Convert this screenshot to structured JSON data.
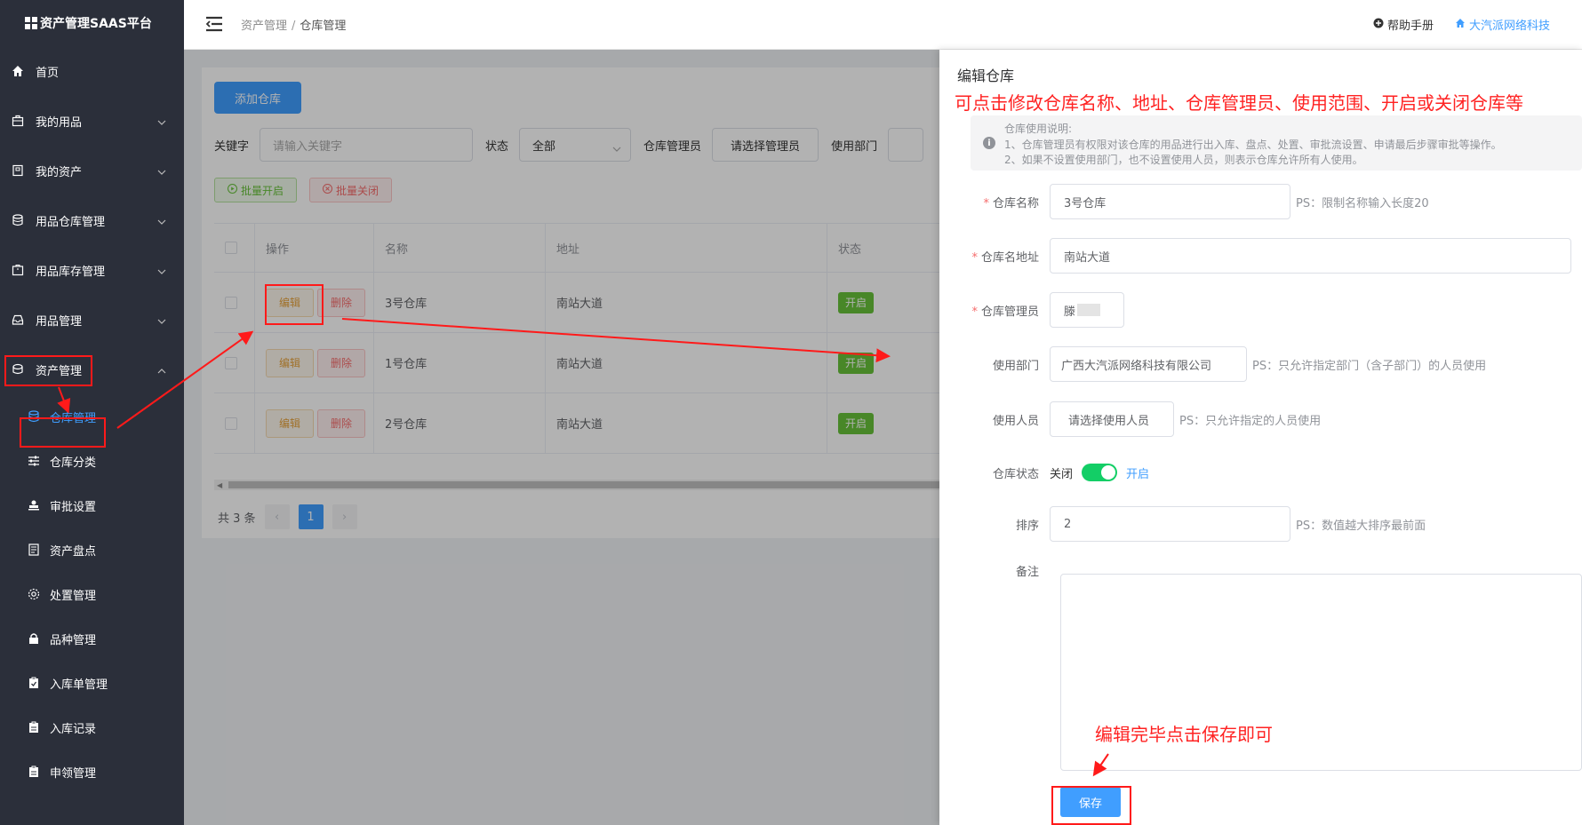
{
  "app": {
    "title": "资产管理SAAS平台"
  },
  "sidebar": {
    "items": [
      {
        "label": "首页",
        "icon": "home-icon"
      },
      {
        "label": "我的用品",
        "icon": "bag-icon"
      },
      {
        "label": "我的资产",
        "icon": "building-icon"
      },
      {
        "label": "用品仓库管理",
        "icon": "database-icon"
      },
      {
        "label": "用品库存管理",
        "icon": "box-icon"
      },
      {
        "label": "用品管理",
        "icon": "tray-icon"
      },
      {
        "label": "资产管理",
        "icon": "asset-icon"
      }
    ],
    "subitems": [
      {
        "label": "仓库管理",
        "icon": "database-icon"
      },
      {
        "label": "仓库分类",
        "icon": "sliders-icon"
      },
      {
        "label": "审批设置",
        "icon": "stamp-icon"
      },
      {
        "label": "资产盘点",
        "icon": "document-icon"
      },
      {
        "label": "处置管理",
        "icon": "gear-icon"
      },
      {
        "label": "品种管理",
        "icon": "lock-icon"
      },
      {
        "label": "入库单管理",
        "icon": "clipboard-icon"
      },
      {
        "label": "入库记录",
        "icon": "clipboard-icon"
      },
      {
        "label": "申领管理",
        "icon": "clipboard-icon"
      }
    ]
  },
  "header": {
    "breadcrumb": [
      "资产管理",
      "仓库管理"
    ],
    "help": "帮助手册",
    "company": "大汽派网络科技"
  },
  "main": {
    "add_button": "添加仓库",
    "filters": {
      "keyword_label": "关键字",
      "keyword_placeholder": "请输入关键字",
      "status_label": "状态",
      "status_value": "全部",
      "manager_label": "仓库管理员",
      "manager_button": "请选择管理员",
      "dept_label": "使用部门"
    },
    "batch_open": "批量开启",
    "batch_close": "批量关闭",
    "table": {
      "headers": [
        "操作",
        "名称",
        "地址",
        "状态"
      ],
      "edit": "编辑",
      "delete": "删除",
      "rows": [
        {
          "name": "3号仓库",
          "address": "南站大道",
          "status": "开启"
        },
        {
          "name": "1号仓库",
          "address": "南站大道",
          "status": "开启"
        },
        {
          "name": "2号仓库",
          "address": "南站大道",
          "status": "开启"
        }
      ]
    },
    "pagination": {
      "total": "共 3 条",
      "prev": "‹",
      "current": "1",
      "next": "›"
    }
  },
  "drawer": {
    "title": "编辑仓库",
    "annotation_top": "可点击修改仓库名称、地址、仓库管理员、使用范围、开启或关闭仓库等",
    "tip_title": "仓库使用说明:",
    "tip_line1": "1、仓库管理员有权限对该仓库的用品进行出入库、盘点、处置、审批流设置、申请最后步骤审批等操作。",
    "tip_line2": "2、如果不设置使用部门，也不设置使用人员，则表示仓库允许所有人使用。",
    "fields": {
      "name_label": "仓库名称",
      "name_value": "3号仓库",
      "name_ps": "PS：限制名称输入长度20",
      "address_label": "仓库名地址",
      "address_value": "南站大道",
      "manager_label": "仓库管理员",
      "manager_value": "滕",
      "dept_label": "使用部门",
      "dept_value": "广西大汽派网络科技有限公司",
      "dept_ps": "PS：只允许指定部门（含子部门）的人员使用",
      "user_label": "使用人员",
      "user_button": "请选择使用人员",
      "user_ps": "PS：只允许指定的人员使用",
      "status_label": "仓库状态",
      "status_off": "关闭",
      "status_on": "开启",
      "sort_label": "排序",
      "sort_value": "2",
      "sort_ps": "PS：数值越大排序最前面",
      "remark_label": "备注"
    },
    "annotation_bottom": "编辑完毕点击保存即可",
    "save": "保存"
  },
  "colors": {
    "primary": "#409eff",
    "sidebar_bg": "#2b2f3a",
    "annotation": "#ff1a1a",
    "switch_on": "#13ce66"
  }
}
